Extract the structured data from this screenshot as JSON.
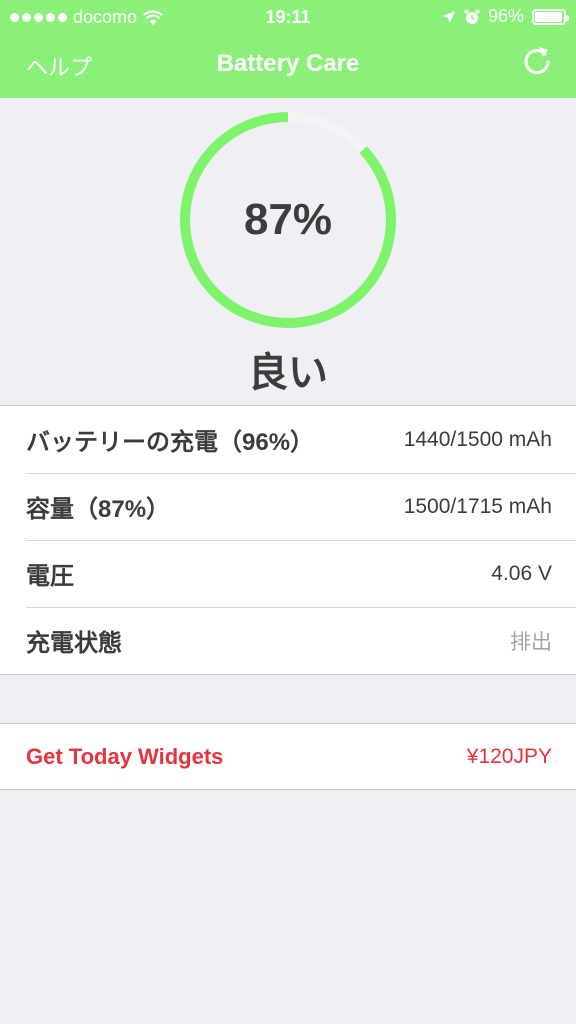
{
  "status_bar": {
    "carrier": "docomo",
    "time": "19:11",
    "battery_percent_label": "96%",
    "battery_level": 0.96,
    "icons": [
      "signal-dots",
      "wifi-icon",
      "location-arrow-icon",
      "alarm-icon",
      "battery-icon"
    ]
  },
  "nav": {
    "help_label": "ヘルプ",
    "title": "Battery Care",
    "refresh_icon": "refresh-icon"
  },
  "gauge": {
    "percent_label": "87%",
    "level": 0.87,
    "health_label": "良い",
    "colors": {
      "fill": "#7ef36c",
      "track": "#f4f4f6"
    }
  },
  "details": [
    {
      "label": "バッテリーの充電（96%）",
      "value": "1440/1500 mAh",
      "muted": false
    },
    {
      "label": "容量（87%）",
      "value": "1500/1715 mAh",
      "muted": false
    },
    {
      "label": "電圧",
      "value": "4.06 V",
      "muted": false
    },
    {
      "label": "充電状態",
      "value": "排出",
      "muted": true
    }
  ],
  "promo": {
    "label": "Get Today Widgets",
    "price": "¥120JPY",
    "color": "#e8333d"
  },
  "colors": {
    "accent": "#8af07a",
    "background": "#efeff4"
  }
}
